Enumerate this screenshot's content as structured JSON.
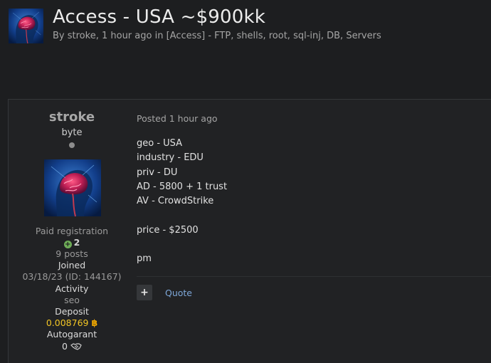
{
  "topic": {
    "title": "Access - USA ~$900kk",
    "meta_by": "By ",
    "author": "stroke",
    "meta_time": ", 1 hour ago in ",
    "forum": "[Access] - FTP, shells, root, sql-inj, DB, Servers"
  },
  "post": {
    "author": {
      "name": "stroke",
      "rank": "byte",
      "group": "Paid registration",
      "reputation": "2",
      "posts": "9 posts",
      "joined_label": "Joined",
      "joined_value": "03/18/23 (ID: 144167)",
      "activity_label": "Activity",
      "activity_value": "seo",
      "deposit_label": "Deposit",
      "deposit_value": "0.008769",
      "autogarant_label": "Autogarant",
      "autogarant_value": "0"
    },
    "posted": "Posted 1 hour ago",
    "body": [
      "geo - USA",
      "industry - EDU",
      "priv - DU",
      "AD - 5800 + 1 trust",
      "AV - CrowdStrike",
      "",
      "price - $2500",
      "",
      "pm"
    ],
    "actions": {
      "multiquote": "+",
      "quote": "Quote"
    }
  },
  "icons": {
    "avatar": "brain-avatar",
    "online_status": "status-dot",
    "reputation": "plus-circle-icon",
    "deposit_currency": "bitcoin-icon",
    "autogarant": "handshake-icon"
  },
  "colors": {
    "background": "#1d1e20",
    "panel": "#212224",
    "deposit": "#f2c524",
    "link": "#7da7d8",
    "reputation_positive": "#6fae58"
  }
}
